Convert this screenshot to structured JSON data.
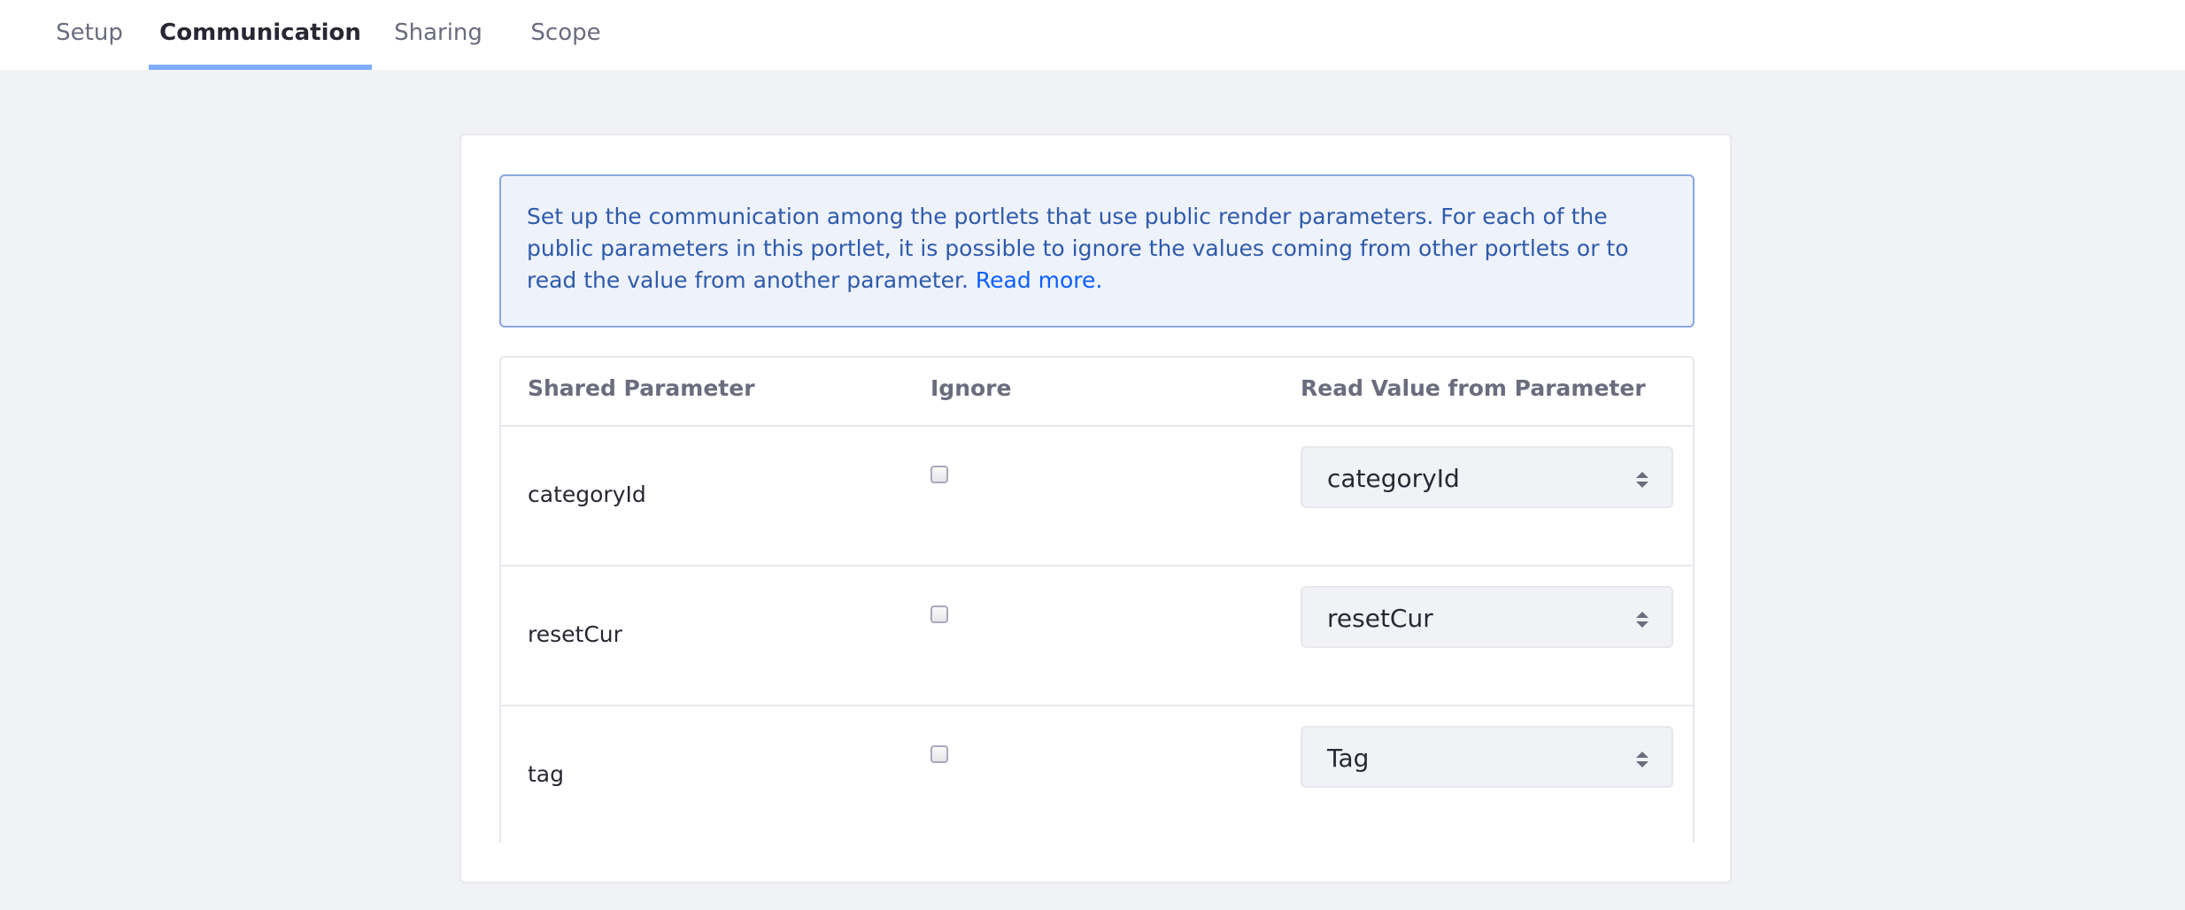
{
  "tabs": [
    {
      "label": "Setup",
      "active": false
    },
    {
      "label": "Communication",
      "active": true
    },
    {
      "label": "Sharing",
      "active": false
    },
    {
      "label": "Scope",
      "active": false
    }
  ],
  "info": {
    "text": "Set up the communication among the portlets that use public render parameters. For each of the public parameters in this portlet, it is possible to ignore the values coming from other portlets or to read the value from another parameter.",
    "link": "Read more."
  },
  "table": {
    "headers": {
      "param": "Shared Parameter",
      "ignore": "Ignore",
      "read": "Read Value from Parameter"
    },
    "rows": [
      {
        "param": "categoryId",
        "ignore": false,
        "read": "categoryId"
      },
      {
        "param": "resetCur",
        "ignore": false,
        "read": "resetCur"
      },
      {
        "param": "tag",
        "ignore": false,
        "read": "Tag"
      }
    ]
  },
  "colors": {
    "accent": "#80acff",
    "info_bg": "#eef2fa",
    "info_border": "#89a7e0",
    "info_text": "#2e5aac",
    "link": "#0b5fff",
    "page_bg": "#f1f2f5"
  },
  "icons": {
    "select_arrows": "chevron-up-down-icon"
  }
}
